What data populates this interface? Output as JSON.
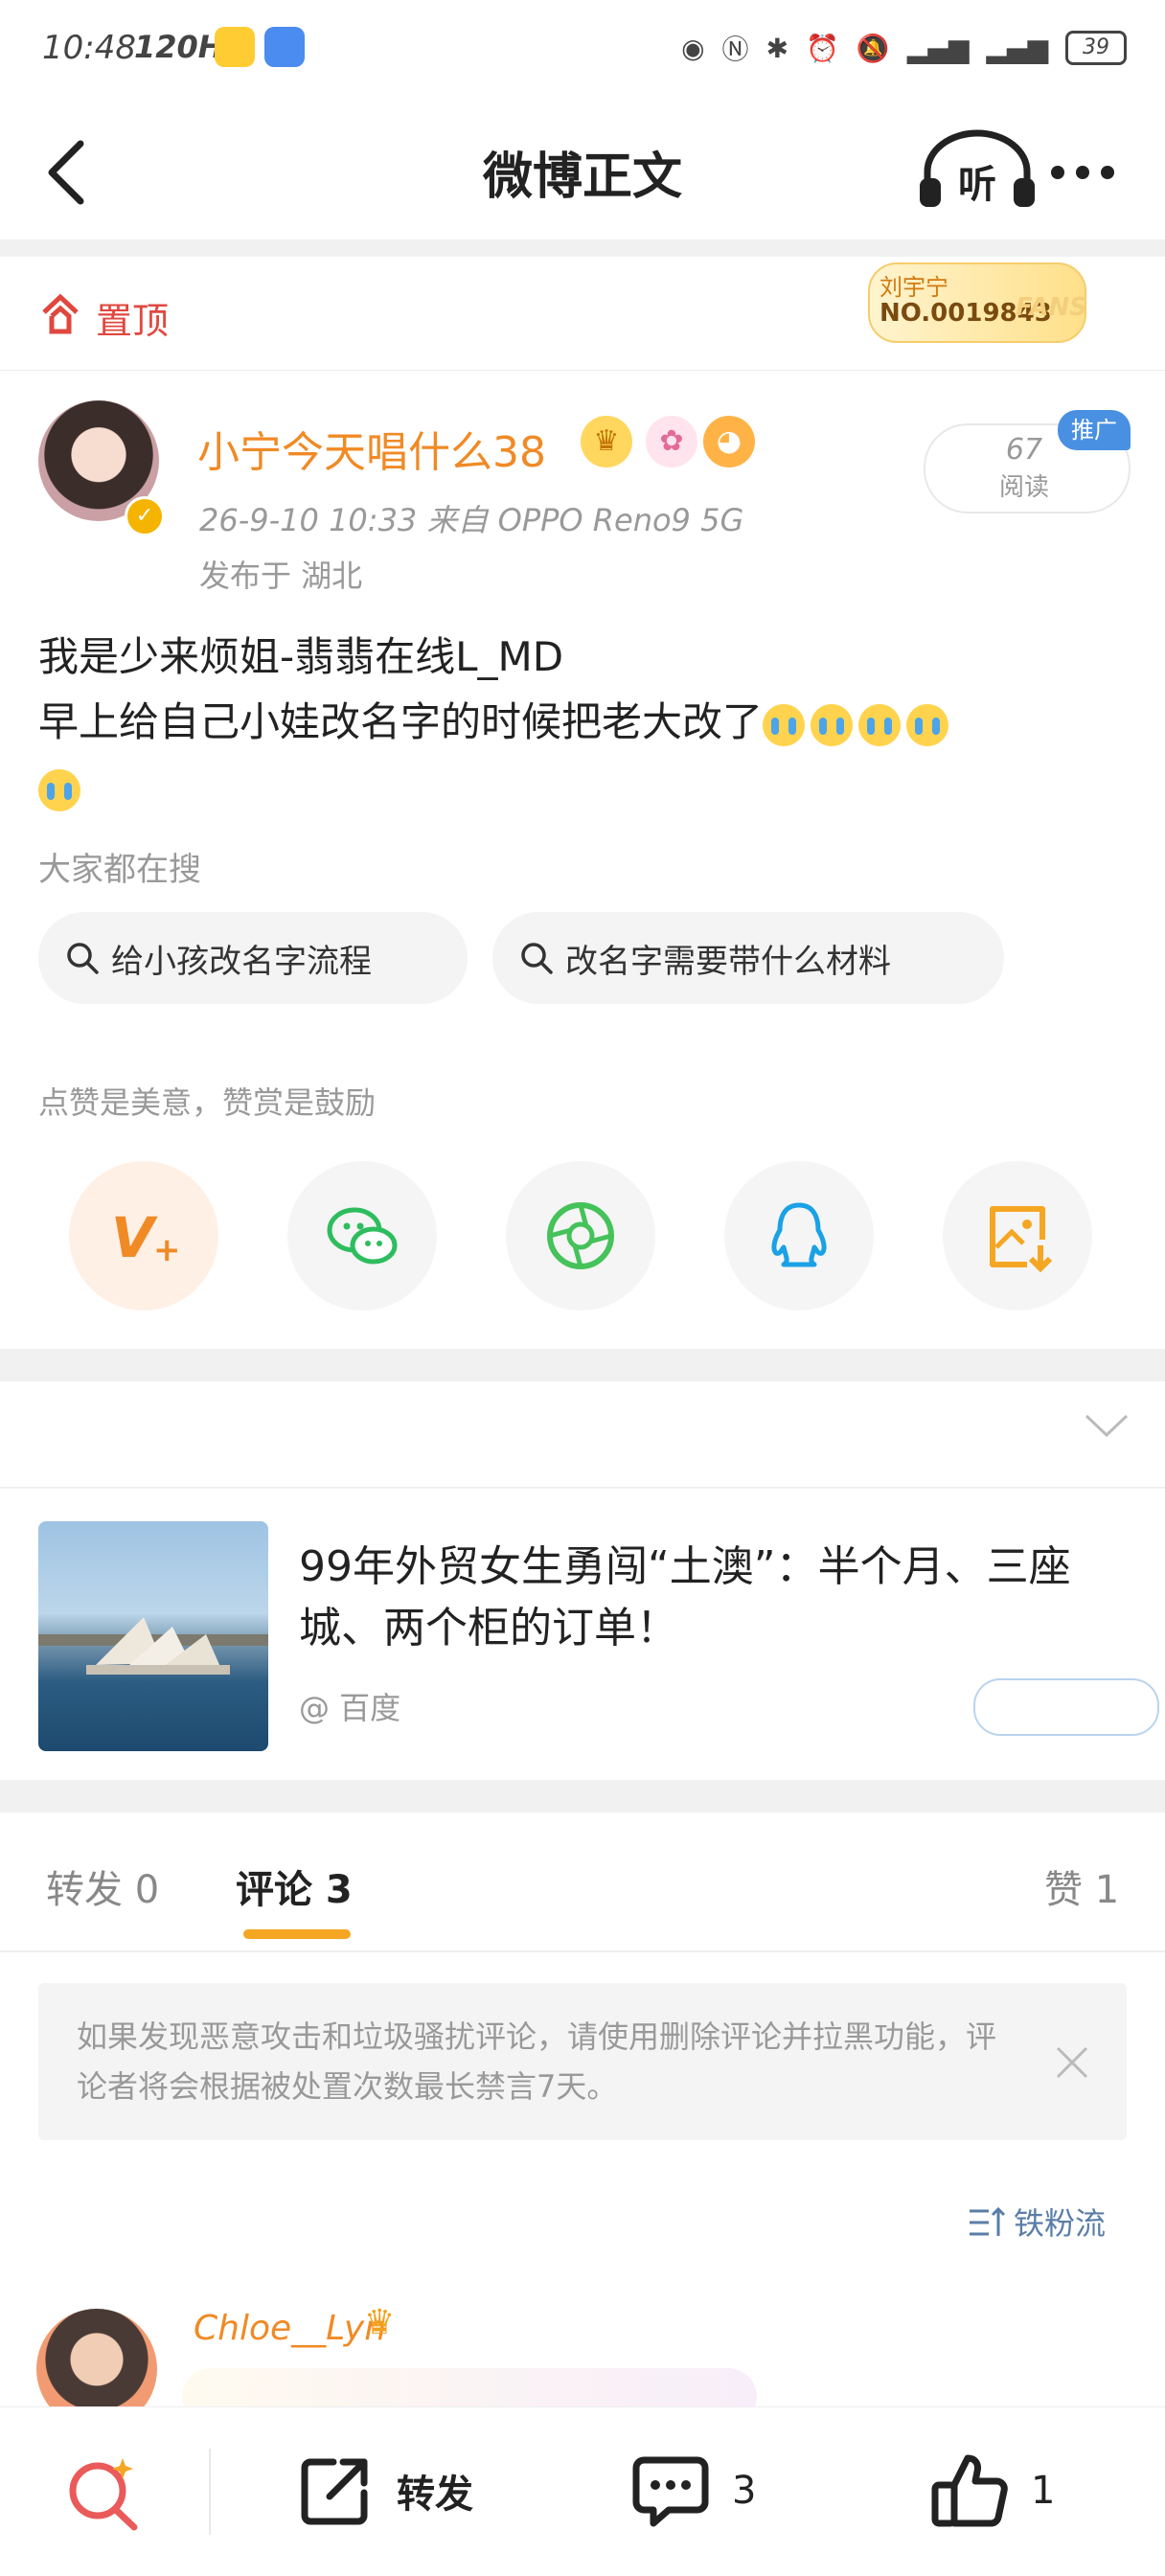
{
  "status_bar": {
    "time": "10:48",
    "refresh": "120HZ",
    "battery": "39"
  },
  "nav": {
    "title": "微博正文"
  },
  "pinned": {
    "label": "置顶",
    "fans_name": "刘宇宁",
    "fans_no": "NO.0019843",
    "fans_tag": "FANS"
  },
  "author": {
    "name": "小宁今天唱什么38",
    "meta": "26-9-10 10:33  来自 OPPO Reno9 5G",
    "location": "发布于 湖北",
    "reads": "67",
    "reads_label": "阅读",
    "promo": "推广"
  },
  "post": {
    "line1": "我是少来烦姐-翡翡在线L_MD",
    "line2": "早上给自己小娃改名字的时候把老大改了"
  },
  "search": {
    "label": "大家都在搜",
    "chips": [
      "给小孩改名字流程",
      "改名字需要带什么材料"
    ]
  },
  "reward_tip": "点赞是美意，赞赏是鼓励",
  "share_icons": [
    "v-plus-icon",
    "wechat-icon",
    "moments-icon",
    "qq-icon",
    "save-image-icon"
  ],
  "ad": {
    "title": "99年外贸女生勇闯“土澳”：半个月、三座城、两个柜的订单！",
    "source": "@ 百度"
  },
  "tabs": {
    "repost": "转发 0",
    "comment": "评论 3",
    "like": "赞 1"
  },
  "notice": "如果发现恶意攻击和垃圾骚扰评论，请使用删除评论并拉黑功能，评论者将会根据被处置次数最长禁言7天。",
  "sort_label": "铁粉流",
  "comment": {
    "user": "Chloe__Lyn"
  },
  "bottom": {
    "repost": "转发",
    "comment_count": "3",
    "like_count": "1"
  },
  "colors": {
    "accent": "#f5a623",
    "pin_red": "#e0473f",
    "name_orange": "#f08a25"
  }
}
